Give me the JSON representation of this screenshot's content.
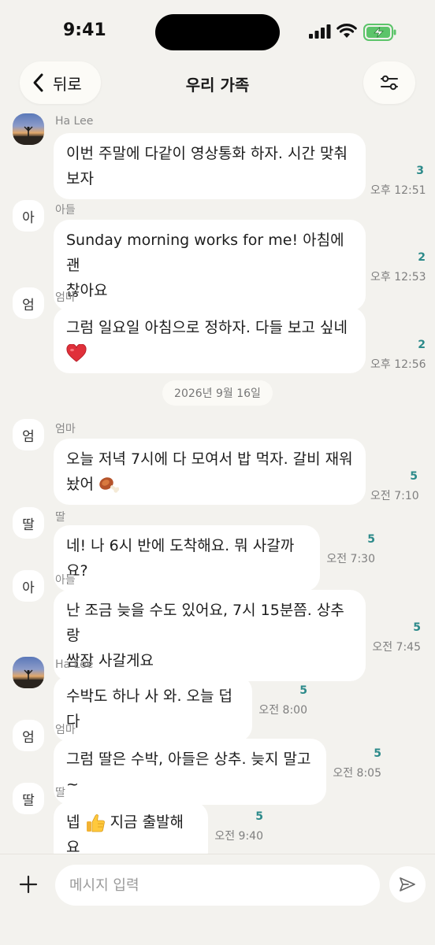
{
  "status_bar": {
    "time": "9:41"
  },
  "header": {
    "back_label": "뒤로",
    "title": "우리 가족"
  },
  "date_divider": "2026년 9월 16일",
  "messages": [
    {
      "avatar": "photo",
      "sender": "Ha Lee",
      "text": "이번 주말에 다같이 영상통화 하자. 시간 맞춰\n보자",
      "read": "3",
      "time": "오후 12:51"
    },
    {
      "avatar": "아",
      "sender": "아들",
      "text": "Sunday morning works for me! 아침에 괜\n찮아요",
      "read": "2",
      "time": "오후 12:53"
    },
    {
      "avatar": "엄",
      "sender": "엄마",
      "text": "그럼 일요일 아침으로 정하자. 다들 보고 싶네",
      "emoji": "heart",
      "read": "2",
      "time": "오후 12:56"
    },
    {
      "avatar": "엄",
      "sender": "엄마",
      "text": "오늘 저녁 7시에 다 모여서 밥 먹자. 갈비 재워\n놨어",
      "emoji": "meat-on-bone",
      "read": "5",
      "time": "오전 7:10"
    },
    {
      "avatar": "딸",
      "sender": "딸",
      "text": "네! 나 6시 반에 도착해요. 뭐 사갈까요?",
      "read": "5",
      "time": "오전 7:30"
    },
    {
      "avatar": "아",
      "sender": "아들",
      "text": "난 조금 늦을 수도 있어요, 7시 15분쯤. 상추랑\n쌈장 사갈게요",
      "read": "5",
      "time": "오전 7:45"
    },
    {
      "avatar": "photo",
      "sender": "Ha Lee",
      "text": "수박도 하나 사 와. 오늘 덥다",
      "read": "5",
      "time": "오전 8:00"
    },
    {
      "avatar": "엄",
      "sender": "엄마",
      "text": "그럼 딸은 수박, 아들은 상추. 늦지 말고~",
      "read": "5",
      "time": "오전 8:05"
    },
    {
      "avatar": "딸",
      "sender": "딸",
      "text_before": "넵",
      "emoji": "thumbs-up",
      "text_after": "지금 출발해요",
      "read": "5",
      "time": "오전 9:40"
    }
  ],
  "input": {
    "placeholder": "메시지 입력"
  },
  "icons": {
    "back": "chevron-left-icon",
    "settings": "sliders-icon",
    "attach": "plus-icon",
    "send": "send-icon"
  },
  "colors": {
    "background": "#f3f2ee",
    "bubble": "#ffffff",
    "read_count": "#2c8a8a"
  }
}
